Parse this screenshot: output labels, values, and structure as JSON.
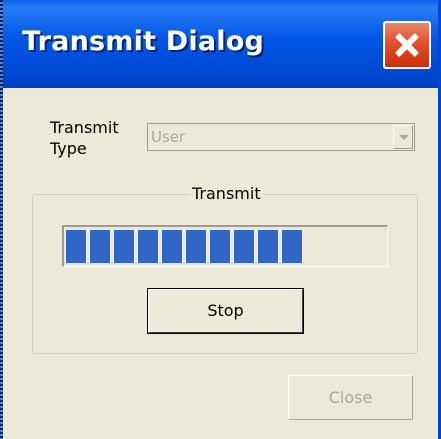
{
  "window": {
    "title": "Transmit Dialog"
  },
  "form": {
    "type_label_line1": "Transmit",
    "type_label_line2": "Type",
    "type_value": "User"
  },
  "group": {
    "title": "Transmit"
  },
  "progress": {
    "filled_segments": 10,
    "total_segments": 13,
    "fraction": 0.77
  },
  "buttons": {
    "stop_label": "Stop",
    "close_label": "Close"
  },
  "colors": {
    "titlebar": "#0055e5",
    "close_button": "#e35a35",
    "progress_fill": "#3266c6",
    "dialog_bg": "#ece9d8",
    "disabled_text": "#aca899"
  },
  "icons": {
    "close": "close-icon",
    "dropdown": "chevron-down-icon"
  }
}
